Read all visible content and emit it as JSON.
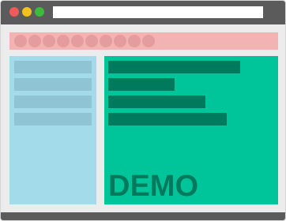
{
  "colors": {
    "chrome": "#5b5b5b",
    "background": "#ececec",
    "close_dot": "#f25a5a",
    "minimize_dot": "#f5c21b",
    "maximize_dot": "#3dbb3d",
    "address_bar": "#ffffff",
    "navbar": "#f3b3b3",
    "nav_circle": "#e59c9c",
    "sidebar": "#a3dbea",
    "sidebar_item": "#8ec4d3",
    "main": "#00c49a",
    "main_bar": "#007a5c",
    "demo_text": "#007a5c"
  },
  "titlebar": {
    "buttons": [
      {
        "name": "close",
        "icon": "close-dot"
      },
      {
        "name": "minimize",
        "icon": "minimize-dot"
      },
      {
        "name": "maximize",
        "icon": "maximize-dot"
      }
    ],
    "address_bar": {
      "value": ""
    }
  },
  "navbar": {
    "item_count": 10
  },
  "sidebar": {
    "item_count": 4
  },
  "main": {
    "placeholder_lines": 4,
    "demo_label": "DEMO"
  }
}
